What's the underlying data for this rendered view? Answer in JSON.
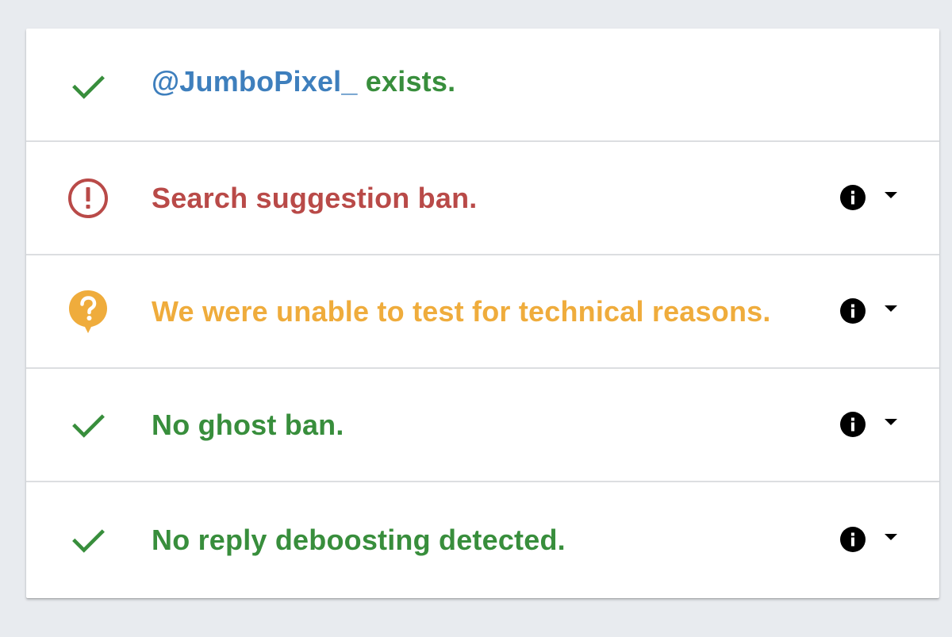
{
  "colors": {
    "ok": "#388e3c",
    "ban": "#b94a48",
    "warn": "#efac3c",
    "handle": "#3e7fbd",
    "background": "#e8ebef"
  },
  "rows": [
    {
      "icon": "check-icon",
      "status": "ok",
      "handle": "@JumboPixel_",
      "text": " exists."
    },
    {
      "icon": "exclamation-circle-icon",
      "status": "ban",
      "text": "Search suggestion ban.",
      "info_icon": "info-icon",
      "dropdown_icon": "caret-down-icon"
    },
    {
      "icon": "question-bubble-icon",
      "status": "warn",
      "text": "We were unable to test for technical reasons.",
      "info_icon": "info-icon",
      "dropdown_icon": "caret-down-icon"
    },
    {
      "icon": "check-icon",
      "status": "ok",
      "text": "No ghost ban.",
      "info_icon": "info-icon",
      "dropdown_icon": "caret-down-icon"
    },
    {
      "icon": "check-icon",
      "status": "ok",
      "text": "No reply deboosting detected.",
      "info_icon": "info-icon",
      "dropdown_icon": "caret-down-icon"
    }
  ]
}
